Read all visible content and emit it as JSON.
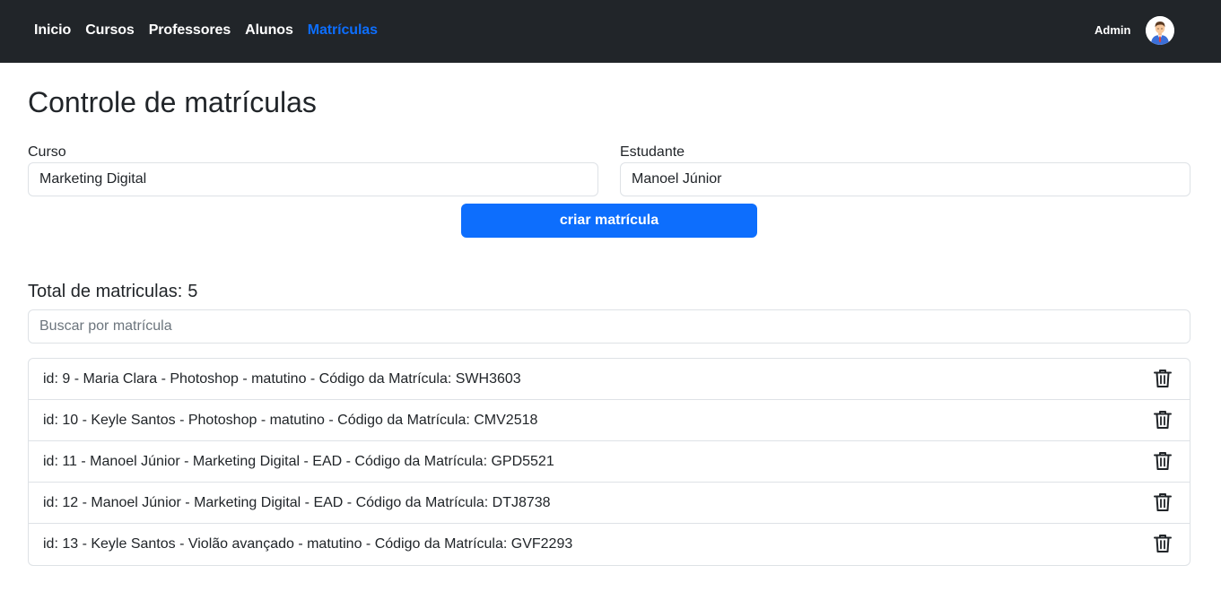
{
  "nav": {
    "links": [
      {
        "label": "Inicio",
        "active": false
      },
      {
        "label": "Cursos",
        "active": false
      },
      {
        "label": "Professores",
        "active": false
      },
      {
        "label": "Alunos",
        "active": false
      },
      {
        "label": "Matrículas",
        "active": true
      }
    ],
    "user_name": "Admin",
    "avatar_icon": "user-avatar-icon",
    "active_color": "#0d6efd",
    "background": "#212529"
  },
  "page": {
    "title": "Controle de matrículas"
  },
  "form": {
    "course_label": "Curso",
    "course_value": "Marketing Digital",
    "student_label": "Estudante",
    "student_value": "Manoel Júnior",
    "submit_label": "criar matrícula",
    "submit_color": "#0d6efd"
  },
  "enrollments": {
    "total_label": "Total de matriculas:",
    "total_count": "5",
    "search_placeholder": "Buscar por matrícula",
    "search_value": "",
    "delete_icon": "trash-icon",
    "items": [
      {
        "text": "id: 9 - Maria Clara - Photoshop - matutino - Código da Matrícula: SWH3603"
      },
      {
        "text": "id: 10 - Keyle Santos - Photoshop - matutino - Código da Matrícula: CMV2518"
      },
      {
        "text": "id: 11 - Manoel Júnior - Marketing Digital - EAD - Código da Matrícula: GPD5521"
      },
      {
        "text": "id: 12 - Manoel Júnior - Marketing Digital - EAD - Código da Matrícula: DTJ8738"
      },
      {
        "text": "id: 13 - Keyle Santos - Violão avançado - matutino - Código da Matrícula: GVF2293"
      }
    ]
  }
}
